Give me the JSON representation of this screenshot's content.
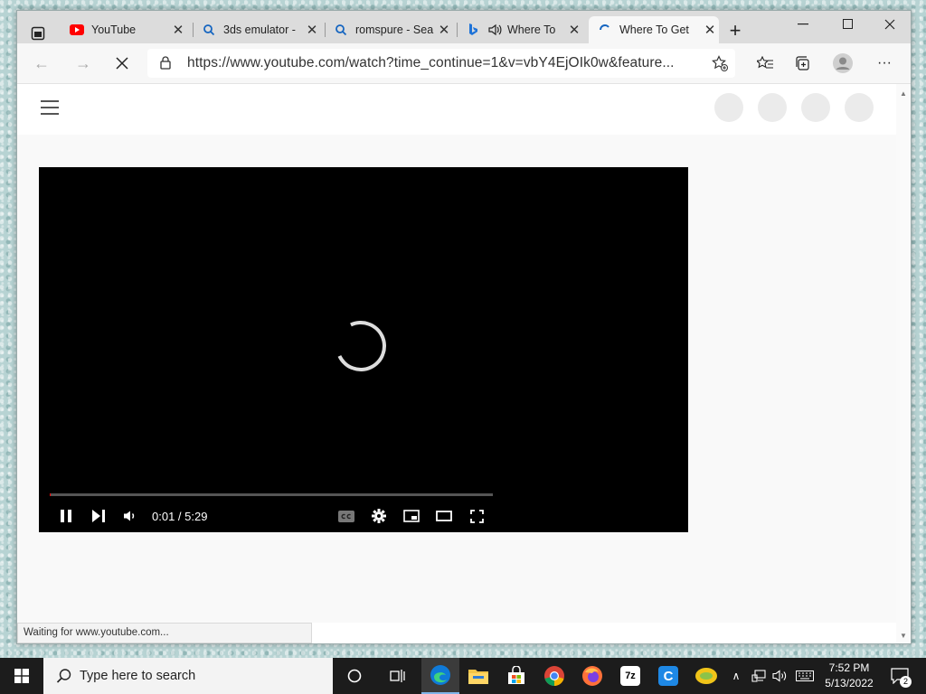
{
  "browser": {
    "tabs": [
      {
        "title": "YouTube",
        "icon": "youtube-icon"
      },
      {
        "title": "3ds emulator -",
        "icon": "search-icon"
      },
      {
        "title": "romspure - Sea",
        "icon": "search-icon"
      },
      {
        "title": "Where To",
        "icon": "bing-icon"
      },
      {
        "title": "Where To Get",
        "icon": "loading-icon"
      }
    ],
    "url": "https://www.youtube.com/watch?time_continue=1&v=vbY4EjOIk0w&feature...",
    "status": "Waiting for www.youtube.com..."
  },
  "player": {
    "time": "0:01 / 5:29",
    "progress": 0.003
  },
  "taskbar": {
    "search_placeholder": "Type here to search",
    "time": "7:52 PM",
    "date": "5/13/2022",
    "notification_count": "2",
    "apps": [
      {
        "name": "7z",
        "color": "#2b2b2b"
      },
      {
        "name": "C",
        "color": "#1e88e5"
      }
    ]
  },
  "colors": {
    "accent": "#ff0000",
    "edge": "#0f7ad8"
  }
}
